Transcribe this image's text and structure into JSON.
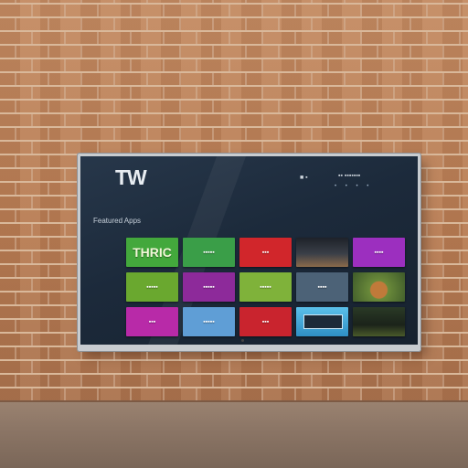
{
  "tv": {
    "logo": "TW",
    "status_left": "■ ▪",
    "status_right": "▪▪ ▪▪▪▪▪▪▪",
    "dots": "• • • •",
    "row_label": "Featured Apps"
  },
  "tiles": [
    {
      "label": "THRIC",
      "color": "#43a83c",
      "name": "tile-1",
      "style": "big"
    },
    {
      "label": "▪▪▪▪▪",
      "color": "#3a9e48",
      "name": "tile-2"
    },
    {
      "label": "▪▪▪",
      "color": "#d1262b",
      "name": "tile-3"
    },
    {
      "label": "",
      "color": "#2b2f36",
      "name": "tile-4",
      "art": "dark-scene"
    },
    {
      "label": "▪▪▪▪",
      "color": "#9c2fbf",
      "name": "tile-5"
    },
    {
      "label": "▪▪▪▪▪",
      "color": "#6aa82f",
      "name": "tile-6"
    },
    {
      "label": "▪▪▪▪▪",
      "color": "#8d2a9a",
      "name": "tile-7"
    },
    {
      "label": "▪▪▪▪▪",
      "color": "#7fb23a",
      "name": "tile-8"
    },
    {
      "label": "▪▪▪▪",
      "color": "#4c6277",
      "name": "tile-9"
    },
    {
      "label": "",
      "color": "#556b3a",
      "name": "tile-10",
      "art": "food"
    },
    {
      "label": "▪▪▪",
      "color": "#b82aa8",
      "name": "tile-11"
    },
    {
      "label": "▪▪▪▪▪",
      "color": "#5f9ed6",
      "name": "tile-12"
    },
    {
      "label": "▪▪▪",
      "color": "#c9242e",
      "name": "tile-13"
    },
    {
      "label": "",
      "color": "#3fa6d8",
      "name": "tile-14",
      "art": "screen-tile"
    },
    {
      "label": "",
      "color": "#2b3a2a",
      "name": "tile-15",
      "art": "dark-scene-2"
    }
  ],
  "colors": {
    "wall": "#b9805a",
    "screen": "#1c2a3b",
    "bezel": "#c8ccd0"
  }
}
